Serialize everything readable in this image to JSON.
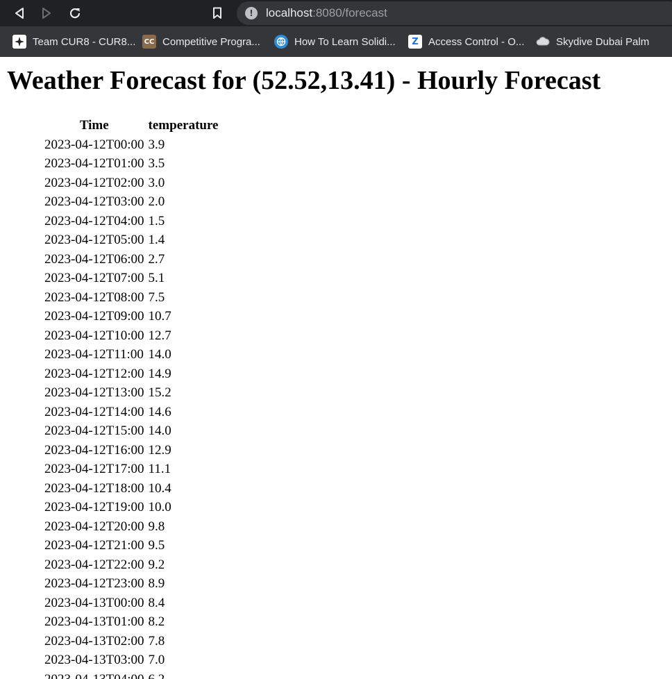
{
  "browser": {
    "url_host": "localhost",
    "url_rest": ":8080/forecast",
    "bookmarks": [
      {
        "label": "Team CUR8 - CUR8...",
        "icon": "sparkle-icon"
      },
      {
        "label": "Competitive Progra...",
        "icon": "cc-icon"
      },
      {
        "label": "How To Learn Solidi...",
        "icon": "globe-icon"
      },
      {
        "label": "Access Control - O...",
        "icon": "z-icon"
      },
      {
        "label": "Skydive Dubai Palm",
        "icon": "cloud-icon"
      }
    ]
  },
  "page": {
    "title": "Weather Forecast for (52.52,13.41) - Hourly Forecast",
    "table": {
      "headers": [
        "Time",
        "temperature"
      ],
      "rows": [
        [
          "2023-04-12T00:00",
          "3.9"
        ],
        [
          "2023-04-12T01:00",
          "3.5"
        ],
        [
          "2023-04-12T02:00",
          "3.0"
        ],
        [
          "2023-04-12T03:00",
          "2.0"
        ],
        [
          "2023-04-12T04:00",
          "1.5"
        ],
        [
          "2023-04-12T05:00",
          "1.4"
        ],
        [
          "2023-04-12T06:00",
          "2.7"
        ],
        [
          "2023-04-12T07:00",
          "5.1"
        ],
        [
          "2023-04-12T08:00",
          "7.5"
        ],
        [
          "2023-04-12T09:00",
          "10.7"
        ],
        [
          "2023-04-12T10:00",
          "12.7"
        ],
        [
          "2023-04-12T11:00",
          "14.0"
        ],
        [
          "2023-04-12T12:00",
          "14.9"
        ],
        [
          "2023-04-12T13:00",
          "15.2"
        ],
        [
          "2023-04-12T14:00",
          "14.6"
        ],
        [
          "2023-04-12T15:00",
          "14.0"
        ],
        [
          "2023-04-12T16:00",
          "12.9"
        ],
        [
          "2023-04-12T17:00",
          "11.1"
        ],
        [
          "2023-04-12T18:00",
          "10.4"
        ],
        [
          "2023-04-12T19:00",
          "10.0"
        ],
        [
          "2023-04-12T20:00",
          "9.8"
        ],
        [
          "2023-04-12T21:00",
          "9.5"
        ],
        [
          "2023-04-12T22:00",
          "9.2"
        ],
        [
          "2023-04-12T23:00",
          "8.9"
        ],
        [
          "2023-04-13T00:00",
          "8.4"
        ],
        [
          "2023-04-13T01:00",
          "8.2"
        ],
        [
          "2023-04-13T02:00",
          "7.8"
        ],
        [
          "2023-04-13T03:00",
          "7.0"
        ],
        [
          "2023-04-13T04:00",
          "6.2"
        ]
      ]
    }
  }
}
